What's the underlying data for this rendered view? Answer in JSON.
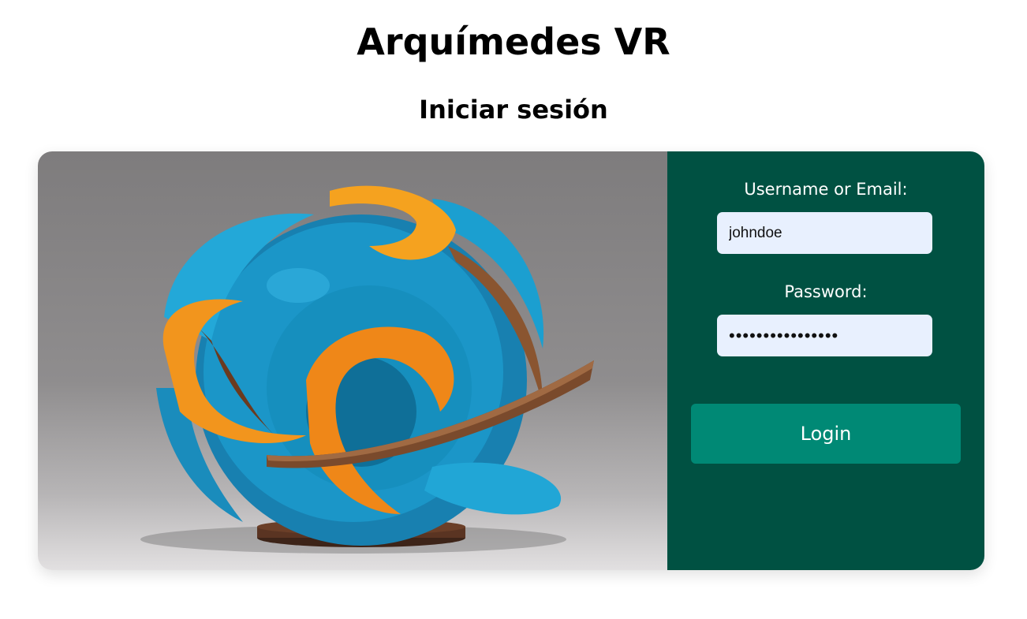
{
  "app": {
    "title": "Arquímedes VR",
    "subtitle": "Iniciar sesión"
  },
  "login_form": {
    "username_label": "Username or Email:",
    "username_value": "johndoe",
    "password_label": "Password:",
    "password_value": "passwordpassword",
    "submit_label": "Login"
  },
  "colors": {
    "panel_background": "#005142",
    "button_background": "#008975",
    "input_background": "#e8f0fe",
    "sculpture_blue": "#1b96c8",
    "sculpture_orange": "#f39a1e",
    "sculpture_wood": "#7a4a2c"
  }
}
